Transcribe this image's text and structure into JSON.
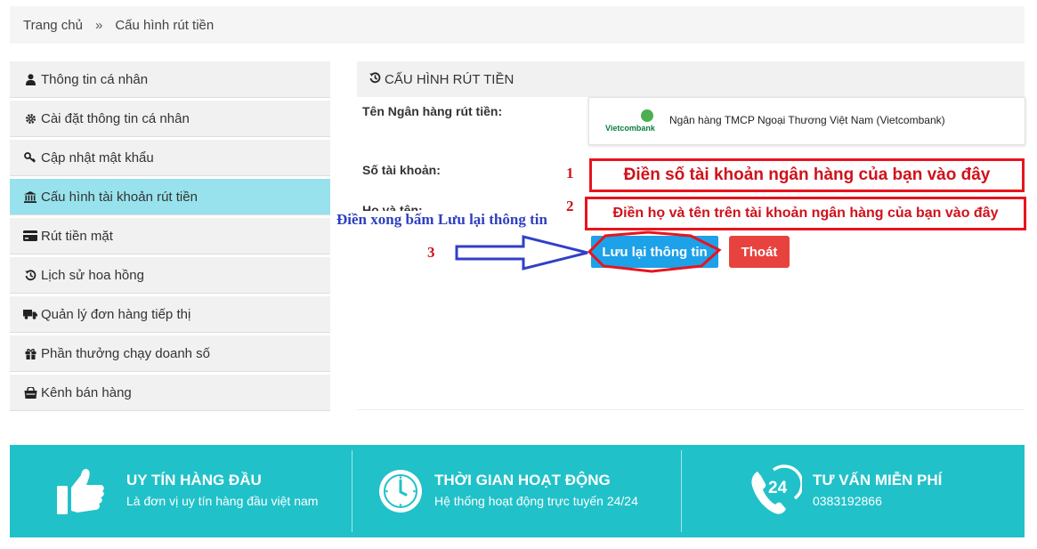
{
  "breadcrumb": {
    "home": "Trang chủ",
    "separator": "»",
    "current": "Cấu hình rút tiền"
  },
  "sidebar": {
    "items": [
      {
        "label": "Thông tin cá nhân",
        "icon": "user-icon"
      },
      {
        "label": "Cài đặt thông tin cá nhân",
        "icon": "gear-icon"
      },
      {
        "label": "Cập nhật mật khẩu",
        "icon": "key-icon"
      },
      {
        "label": "Cấu hình tài khoản rút tiền",
        "icon": "bank-icon",
        "active": true
      },
      {
        "label": "Rút tiền mặt",
        "icon": "credit-card-icon"
      },
      {
        "label": "Lịch sử hoa hồng",
        "icon": "history-icon"
      },
      {
        "label": "Quản lý đơn hàng tiếp thị",
        "icon": "truck-icon"
      },
      {
        "label": "Phần thưởng chạy doanh số",
        "icon": "gift-icon"
      },
      {
        "label": "Kênh bán hàng",
        "icon": "shop-icon"
      }
    ]
  },
  "panel": {
    "title": "CẤU HÌNH RÚT TIỀN",
    "bank_label": "Tên Ngân hàng rút tiền:",
    "bank_logo_text": "Vietcombank",
    "bank_name": "Ngân hàng TMCP Ngoại Thương Việt Nam (Vietcombank)",
    "account_label": "Số tài khoản:",
    "name_label": "Họ và tên:",
    "save_label": "Lưu lại thông tin",
    "exit_label": "Thoát"
  },
  "annotations": {
    "num1": "1",
    "num2": "2",
    "num3": "3",
    "callout1": "Điền số tài khoản ngân hàng của bạn vào đây",
    "callout2": "Điền họ và tên trên tài khoản ngân hàng của bạn vào đây",
    "note3": "Điền xong bấm Lưu lại thông tin",
    "callout_color": "#e8141d",
    "note_color": "#2d3fc0"
  },
  "footer": {
    "color": "#21c1c9",
    "cols": [
      {
        "title": "UY TÍN HÀNG ĐẦU",
        "sub": "Là đơn vị uy tín hàng đầu việt nam",
        "icon": "thumbs-up-icon"
      },
      {
        "title": "THỜI GIAN HOẠT ĐỘNG",
        "sub": "Hệ thống hoạt động trực tuyến 24/24",
        "icon": "clock-icon"
      },
      {
        "title": "TƯ VẤN MIỄN PHÍ",
        "sub": "0383192866",
        "icon": "phone-24-icon",
        "badge": "24"
      }
    ]
  }
}
